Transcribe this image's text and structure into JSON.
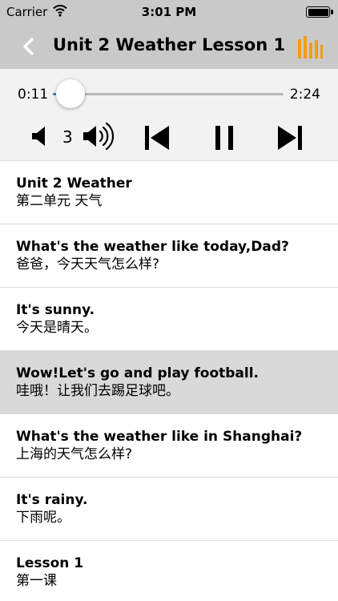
{
  "status_bar": {
    "carrier": "Carrier",
    "time": "3:01 PM",
    "icons": [
      "wifi-icon",
      "battery-icon"
    ]
  },
  "nav": {
    "title": "Unit 2 Weather Lesson 1",
    "back_icon": "chevron-left-icon",
    "chart_icon": "bar-chart-icon",
    "accent_color": "#f39c12"
  },
  "player": {
    "elapsed": "0:11",
    "duration": "2:24",
    "progress": 0.076,
    "volume_level": "3",
    "accent_color": "#1e8fe6",
    "icons": [
      "volume-down-icon",
      "volume-up-icon",
      "skip-previous-icon",
      "pause-icon",
      "skip-next-icon"
    ]
  },
  "lessons": [
    {
      "en": "Unit 2 Weather",
      "zh": "第二单元 天气",
      "active": false
    },
    {
      "en": "What's the weather like today,Dad?",
      "zh": "爸爸，今天天气怎么样?",
      "active": false
    },
    {
      "en": "It's sunny.",
      "zh": "今天是晴天。",
      "active": false
    },
    {
      "en": "Wow!Let's go and play football.",
      "zh": "哇哦！让我们去踢足球吧。",
      "active": true
    },
    {
      "en": "What's the weather like in Shanghai?",
      "zh": "上海的天气怎么样?",
      "active": false
    },
    {
      "en": "It's rainy.",
      "zh": "下雨呢。",
      "active": false
    },
    {
      "en": "Lesson 1",
      "zh": "第一课",
      "active": false
    }
  ]
}
